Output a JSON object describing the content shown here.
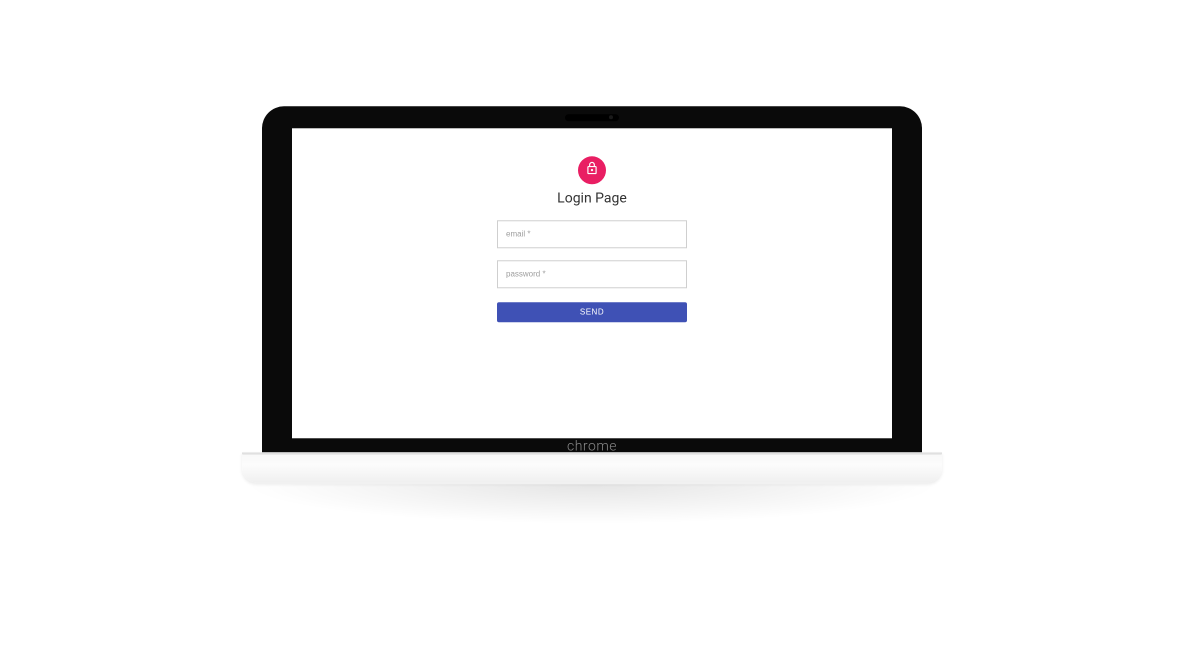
{
  "login": {
    "title": "Login Page",
    "email_placeholder": "email *",
    "password_placeholder": "password *",
    "submit_label": "SEND"
  },
  "device": {
    "brand_label": "chrome"
  },
  "colors": {
    "accent": "#e91e63",
    "primary_button": "#3f51b5"
  }
}
